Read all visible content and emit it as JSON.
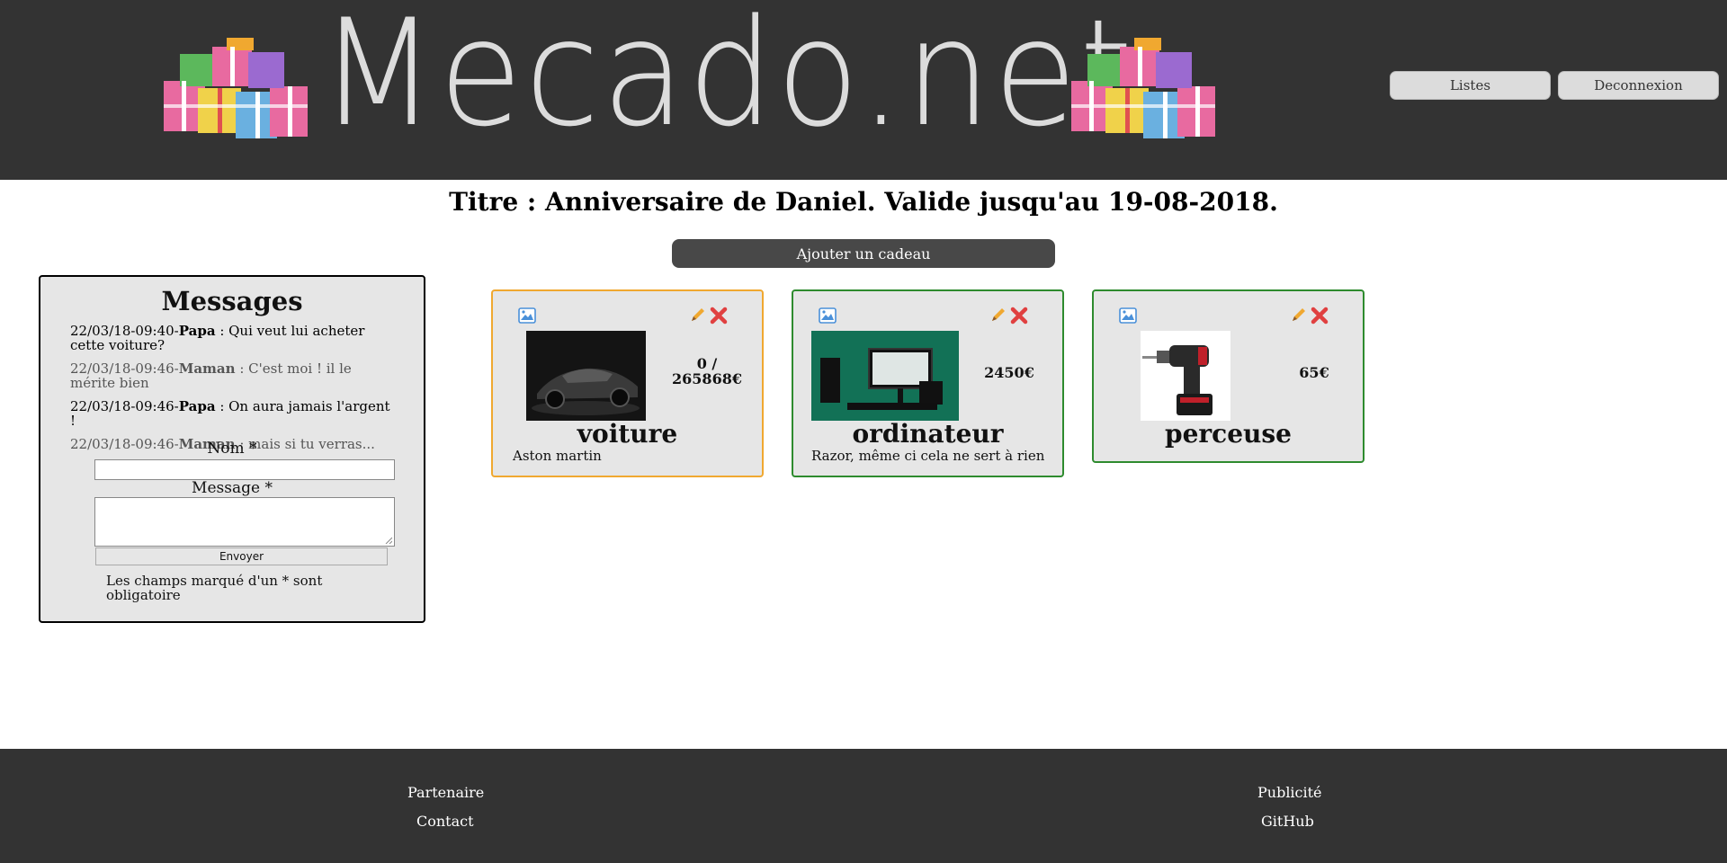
{
  "header": {
    "logo_text": "Mecado.net",
    "nav": {
      "lists": "Listes",
      "logout": "Deconnexion"
    }
  },
  "page": {
    "title": "Titre : Anniversaire de Daniel. Valide jusqu'au 19-08-2018.",
    "add_gift": "Ajouter un cadeau"
  },
  "messages": {
    "heading": "Messages",
    "items": [
      {
        "date": "22/03/18-09:40-",
        "author": "Papa",
        "text": " : Qui veut lui acheter cette voiture?"
      },
      {
        "date": "22/03/18-09:46-",
        "author": "Maman",
        "text": " : C'est moi ! il le mérite bien"
      },
      {
        "date": "22/03/18-09:46-",
        "author": "Papa",
        "text": " : On aura jamais l'argent !"
      },
      {
        "date": "22/03/18-09:46-",
        "author": "Maman",
        "text": " : mais si tu verras..."
      }
    ],
    "name_label": "Nom *",
    "message_label": "Message *",
    "send": "Envoyer",
    "note": "Les champs marqué d'un * sont obligatoire"
  },
  "gifts": [
    {
      "name": "voiture",
      "price": "0 / 265868€",
      "description": "Aston martin",
      "border": "#f0a830"
    },
    {
      "name": "ordinateur",
      "price": "2450€",
      "description": "Razor, même ci cela ne sert à rien",
      "border": "#2e8b2e"
    },
    {
      "name": "perceuse",
      "price": "65€",
      "description": "",
      "border": "#2e8b2e"
    }
  ],
  "footer": {
    "partner": "Partenaire",
    "contact": "Contact",
    "ads": "Publicité",
    "github": "GitHub"
  },
  "colors": {
    "header_bg": "#333333",
    "card_bg": "#e6e6e6",
    "reserved_border": "#f0a830",
    "available_border": "#2e8b2e"
  }
}
